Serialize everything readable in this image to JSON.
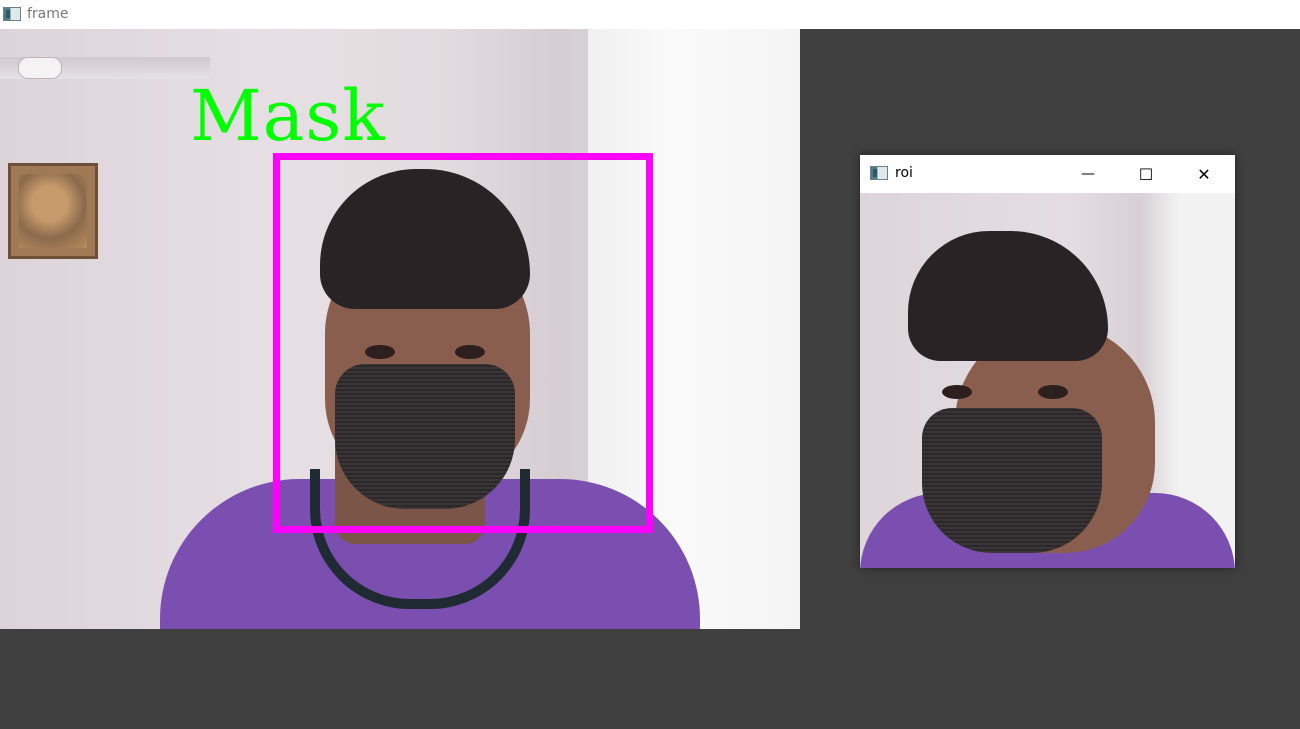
{
  "main_window": {
    "title": "frame"
  },
  "frame": {
    "label": "Mask",
    "label_color": "#00ff00",
    "box_color": "#ff00ff"
  },
  "roi_window": {
    "title": "roi",
    "minimize_glyph": "—",
    "maximize_glyph": "☐",
    "close_glyph": "✕"
  },
  "colors": {
    "background": "#404040",
    "titlebar": "#ffffff"
  }
}
